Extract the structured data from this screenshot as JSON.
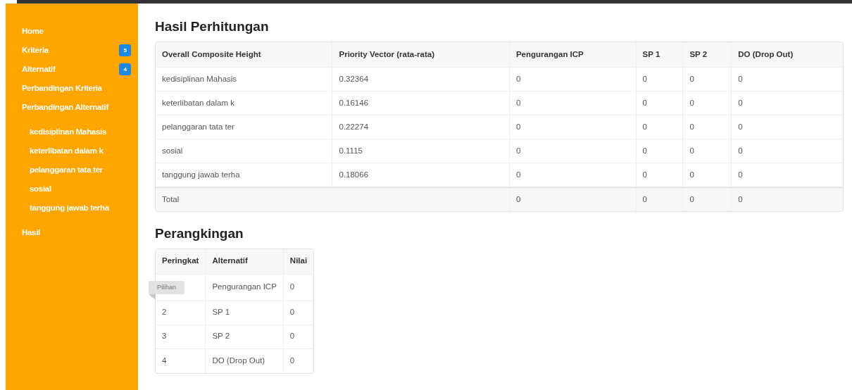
{
  "sidebar": {
    "items": [
      {
        "label": "Home"
      },
      {
        "label": "Kriteria",
        "badge": "5"
      },
      {
        "label": "Alternatif",
        "badge": "4"
      },
      {
        "label": "Perbandingan Kriteria"
      },
      {
        "label": "Perbandingan Alternatif",
        "children": [
          {
            "label": "kedisiplinan Mahasis"
          },
          {
            "label": "keterlibatan dalam k"
          },
          {
            "label": "pelanggaran tata ter"
          },
          {
            "label": "sosial"
          },
          {
            "label": "tanggung jawab terha"
          }
        ]
      },
      {
        "label": "Hasil"
      }
    ]
  },
  "results": {
    "title": "Hasil Perhitungan",
    "columns": [
      "Overall Composite Height",
      "Priority Vector (rata-rata)",
      "Pengurangan ICP",
      "SP 1",
      "SP 2",
      "DO (Drop Out)"
    ],
    "rows": [
      [
        "kedisiplinan Mahasis",
        "0.32364",
        "0",
        "0",
        "0",
        "0"
      ],
      [
        "keterlibatan dalam k",
        "0.16146",
        "0",
        "0",
        "0",
        "0"
      ],
      [
        "pelanggaran tata ter",
        "0.22274",
        "0",
        "0",
        "0",
        "0"
      ],
      [
        "sosial",
        "0.1115",
        "0",
        "0",
        "0",
        "0"
      ],
      [
        "tanggung jawab terha",
        "0.18066",
        "0",
        "0",
        "0",
        "0"
      ]
    ],
    "total": {
      "label": "Total",
      "values": [
        "0",
        "0",
        "0",
        "0"
      ]
    }
  },
  "ranking": {
    "title": "Perangkingan",
    "columns": [
      "Peringkat",
      "Alternatif",
      "Nilai"
    ],
    "rows": [
      {
        "ribbon": "Pilihan",
        "alternative": "Pengurangan ICP",
        "value": "0"
      },
      {
        "rank": "2",
        "alternative": "SP 1",
        "value": "0"
      },
      {
        "rank": "3",
        "alternative": "SP 2",
        "value": "0"
      },
      {
        "rank": "4",
        "alternative": "DO (Drop Out)",
        "value": "0"
      }
    ]
  }
}
